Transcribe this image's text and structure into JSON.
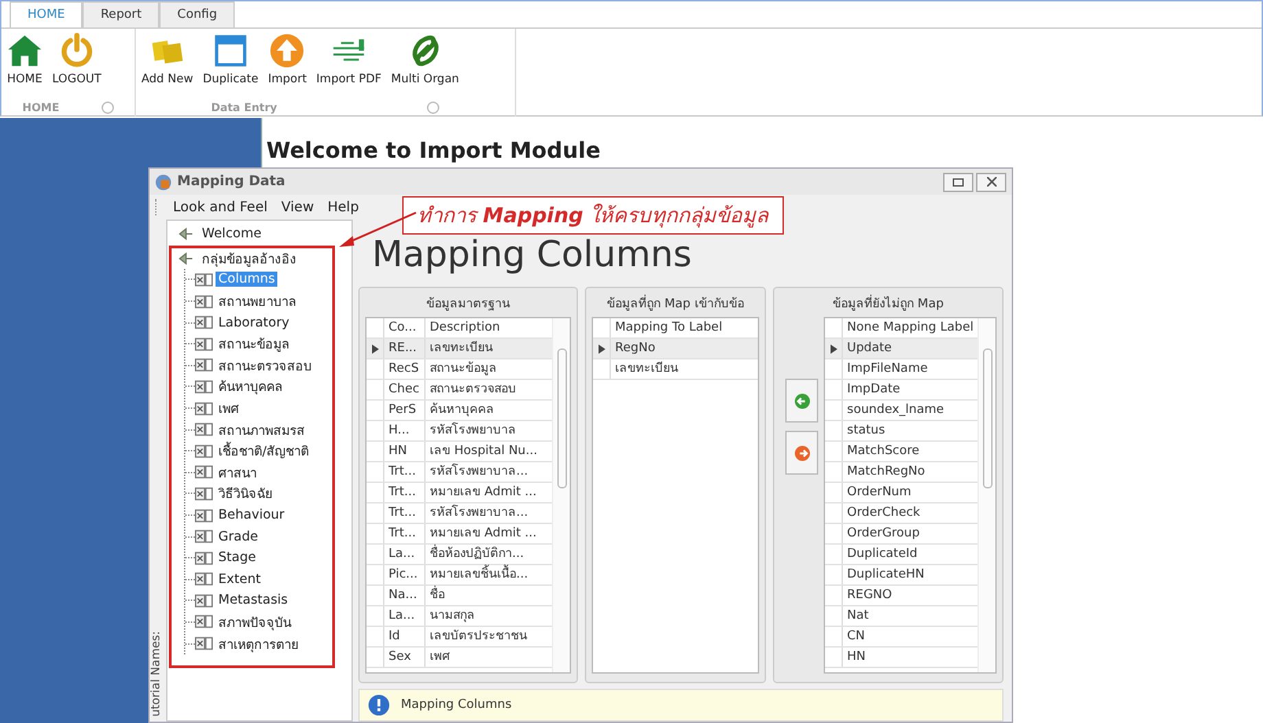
{
  "ribbon": {
    "tabs": [
      {
        "label": "HOME",
        "selected": true
      },
      {
        "label": "Report",
        "selected": false
      },
      {
        "label": "Config",
        "selected": false
      }
    ],
    "groups": [
      {
        "label": "HOME",
        "buttons": [
          {
            "label": "HOME",
            "kind": "home"
          },
          {
            "label": "LOGOUT",
            "kind": "power"
          }
        ]
      },
      {
        "label": "Data Entry",
        "buttons": [
          {
            "label": "Add New",
            "kind": "folders"
          },
          {
            "label": "Duplicate",
            "kind": "window"
          },
          {
            "label": "Import",
            "kind": "upload"
          },
          {
            "label": "Import PDF",
            "kind": "network"
          },
          {
            "label": "Multi Organ",
            "kind": "swirl"
          }
        ]
      }
    ]
  },
  "page": {
    "heading": "Welcome to Import Module"
  },
  "dialog": {
    "title": "Mapping Data",
    "menu": [
      "Look and Feel",
      "View",
      "Help"
    ],
    "tree": [
      {
        "label": "Welcome",
        "selected": false
      },
      {
        "label": "กลุ่มข้อมูลอ้างอิง",
        "selected": false,
        "children": [
          {
            "label": "Columns",
            "selected": true
          },
          {
            "label": "สถานพยาบาล",
            "selected": false
          },
          {
            "label": "Laboratory",
            "selected": false
          },
          {
            "label": "สถานะข้อมูล",
            "selected": false
          },
          {
            "label": "สถานะตรวจสอบ",
            "selected": false
          },
          {
            "label": "ค้นหาบุคคล",
            "selected": false
          },
          {
            "label": "เพศ",
            "selected": false
          },
          {
            "label": "สถานภาพสมรส",
            "selected": false
          },
          {
            "label": "เชื้อชาติ/สัญชาติ",
            "selected": false
          },
          {
            "label": "ศาสนา",
            "selected": false
          },
          {
            "label": "วิธีวินิจฉัย",
            "selected": false
          },
          {
            "label": "Behaviour",
            "selected": false
          },
          {
            "label": "Grade",
            "selected": false
          },
          {
            "label": "Stage",
            "selected": false
          },
          {
            "label": "Extent",
            "selected": false
          },
          {
            "label": "Metastasis",
            "selected": false
          },
          {
            "label": "สภาพปัจจุบัน",
            "selected": false
          },
          {
            "label": "สาเหตุการตาย",
            "selected": false
          }
        ]
      }
    ],
    "side_label": "utorial Names:",
    "callout": "ทำการ **Mapping** ให้ครบทุกกลุ่มข้อมูล",
    "heading": "Mapping Columns",
    "panels": [
      {
        "kind": "standard",
        "title": "ข้อมูลมาตรฐาน",
        "columns": [
          "Co...",
          "Description"
        ],
        "rows": [
          {
            "cells": [
              "RE...",
              "เลขทะเบียน"
            ],
            "current": true
          },
          {
            "cells": [
              "RecS",
              "สถานะข้อมูล"
            ],
            "current": false
          },
          {
            "cells": [
              "Chec",
              "สถานะตรวจสอบ"
            ],
            "current": false
          },
          {
            "cells": [
              "PerS",
              "ค้นหาบุคคล"
            ],
            "current": false
          },
          {
            "cells": [
              "H...",
              "รหัสโรงพยาบาล"
            ],
            "current": false
          },
          {
            "cells": [
              "HN",
              "เลข Hospital Nu..."
            ],
            "current": false
          },
          {
            "cells": [
              "Trt...",
              "รหัสโรงพยาบาล..."
            ],
            "current": false
          },
          {
            "cells": [
              "Trt...",
              "หมายเลข Admit ..."
            ],
            "current": false
          },
          {
            "cells": [
              "Trt...",
              "รหัสโรงพยาบาล..."
            ],
            "current": false
          },
          {
            "cells": [
              "Trt...",
              "หมายเลข Admit ..."
            ],
            "current": false
          },
          {
            "cells": [
              "La...",
              "ชื่อห้องปฏิบัติกา..."
            ],
            "current": false
          },
          {
            "cells": [
              "Pic...",
              "หมายเลขชิ้นเนื้อ..."
            ],
            "current": false
          },
          {
            "cells": [
              "Na...",
              "ชื่อ"
            ],
            "current": false
          },
          {
            "cells": [
              "La...",
              "นามสกุล"
            ],
            "current": false
          },
          {
            "cells": [
              "Id",
              "เลขบัตรประชาชน"
            ],
            "current": false
          },
          {
            "cells": [
              "Sex",
              "เพศ"
            ],
            "current": false
          }
        ]
      },
      {
        "kind": "mapped",
        "title": "ข้อมูลที่ถูก Map เข้ากับข้อ",
        "columns": [
          "Mapping To Label"
        ],
        "rows": [
          {
            "cells": [
              "RegNo"
            ],
            "current": true
          },
          {
            "cells": [
              "เลขทะเบียน"
            ],
            "current": false
          }
        ]
      },
      {
        "kind": "unmapped",
        "title": "ข้อมูลที่ยังไม่ถูก Map",
        "columns": [
          "None Mapping Label"
        ],
        "rows": [
          {
            "cells": [
              "Update"
            ],
            "current": true
          },
          {
            "cells": [
              "ImpFileName"
            ],
            "current": false
          },
          {
            "cells": [
              "ImpDate"
            ],
            "current": false
          },
          {
            "cells": [
              "soundex_lname"
            ],
            "current": false
          },
          {
            "cells": [
              "status"
            ],
            "current": false
          },
          {
            "cells": [
              "MatchScore"
            ],
            "current": false
          },
          {
            "cells": [
              "MatchRegNo"
            ],
            "current": false
          },
          {
            "cells": [
              "OrderNum"
            ],
            "current": false
          },
          {
            "cells": [
              "OrderCheck"
            ],
            "current": false
          },
          {
            "cells": [
              "OrderGroup"
            ],
            "current": false
          },
          {
            "cells": [
              "DuplicateId"
            ],
            "current": false
          },
          {
            "cells": [
              "DuplicateHN"
            ],
            "current": false
          },
          {
            "cells": [
              "REGNO"
            ],
            "current": false
          },
          {
            "cells": [
              "Nat"
            ],
            "current": false
          },
          {
            "cells": [
              "CN"
            ],
            "current": false
          },
          {
            "cells": [
              "HN"
            ],
            "current": false
          }
        ]
      }
    ],
    "info": "Mapping Columns"
  }
}
